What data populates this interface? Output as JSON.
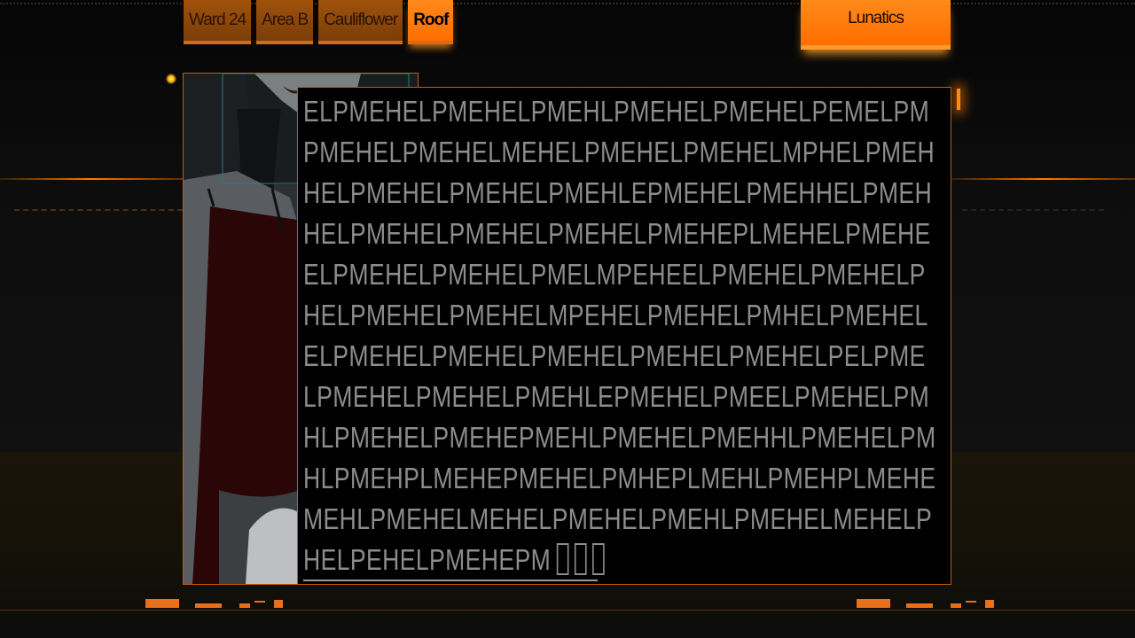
{
  "tabs": [
    {
      "label": "Ward 24",
      "active": false
    },
    {
      "label": "Area B",
      "active": false
    },
    {
      "label": "Cauliflower",
      "active": false
    },
    {
      "label": "Roof",
      "active": true
    }
  ],
  "header_right": {
    "label": "Lunatics"
  },
  "colors": {
    "accent": "#ff7a00",
    "text": "#8c8c8c",
    "panel": "#000000"
  },
  "text_lines": [
    "ELPMEHELPMEHELPMEHLPMEHELPMEHELPEMELPM",
    "PMEHELPMEHELMEHELPMEHELPMEHELMPHELPMEH",
    "HELPMEHELPMEHELPMEHLEPMEHELPMEHHELPMEH",
    "HELPMEHELPMEHELPMEHELPMEHEPLMEHELPMEHE",
    "ELPMEHELPMEHELPMELMPEHEELPMEHELPMEHELP",
    "HELPMEHELPMEHELMPEHELPMEHELPMHELPMEHEL",
    "ELPMEHELPMEHELPMEHELPMEHELPMEHELPELPME",
    "LPMEHELPMEHELPMEHLEPMEHELPMEELPMEHELPM",
    "HLPMEHELPMEHEPMEHLPMEHELPMEHHLPMEHELPM",
    "HLPMEHPLMEHEPMEHELPMHEPLMEHLPMEHPLMEHE",
    "MEHLPMEHELMEHELPMEHELPMEHLPMEHELMEHELP"
  ],
  "last_line": {
    "text": "HELPEHELPMEHEPM",
    "box_glyphs": 3
  }
}
